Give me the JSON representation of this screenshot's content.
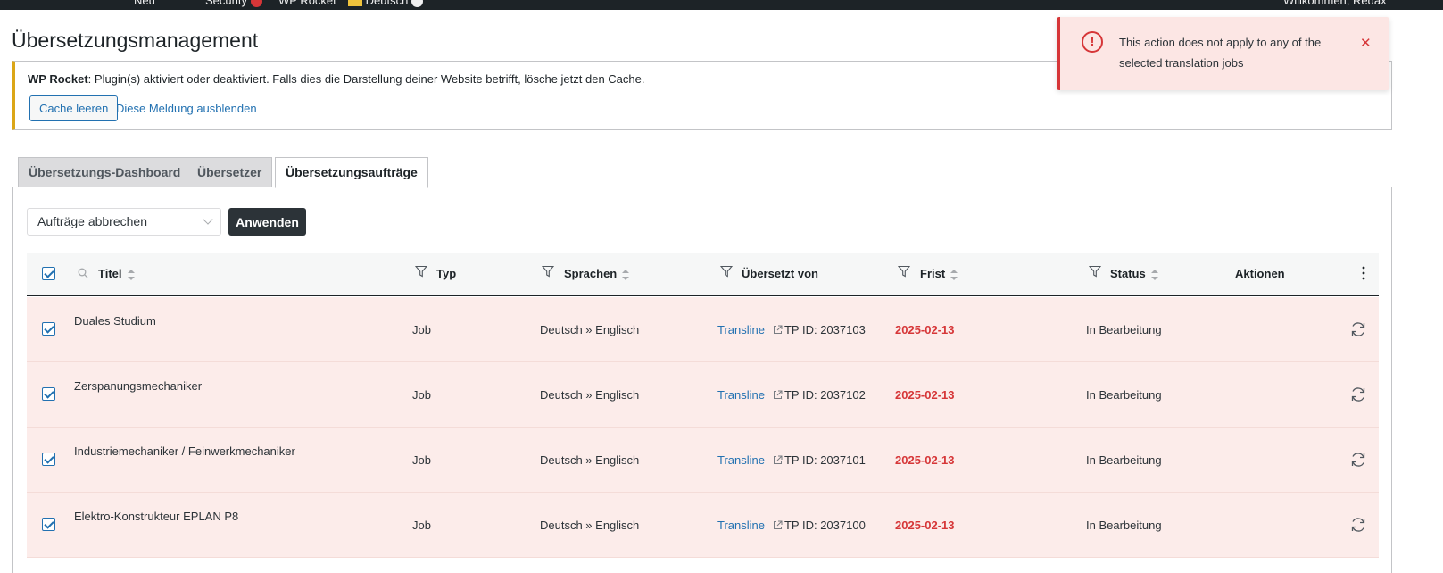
{
  "admin_bar": {
    "items": [
      "Neu",
      "Security",
      "WP Rocket",
      "Deutsch"
    ],
    "greeting": "Willkommen, Redax"
  },
  "page": {
    "title": "Übersetzungsmanagement"
  },
  "notice": {
    "brand": "WP Rocket",
    "message": ": Plugin(s) aktiviert oder deaktiviert. Falls dies die Darstellung deiner Website betrifft, lösche jetzt den Cache.",
    "cache_button": "Cache leeren",
    "dismiss_link": "Diese Meldung ausblenden"
  },
  "toast": {
    "message": "This action does not apply to any of the selected translation jobs",
    "icon": "alert-circle-icon"
  },
  "tabs": [
    {
      "label": "Übersetzungs-Dashboard"
    },
    {
      "label": "Übersetzer"
    },
    {
      "label": "Übersetzungsaufträge"
    }
  ],
  "bulk": {
    "selected": "Aufträge abbrechen",
    "apply": "Anwenden"
  },
  "columns": {
    "title": "Titel",
    "type": "Typ",
    "languages": "Sprachen",
    "translated_by": "Übersetzt von",
    "deadline": "Frist",
    "status": "Status",
    "actions": "Aktionen"
  },
  "rows": [
    {
      "title": "Duales Studium",
      "type": "Job",
      "languages": "Deutsch » Englisch",
      "translator": "Transline",
      "tp": "TP ID: 2037103",
      "deadline": "2025-02-13",
      "status": "In Bearbeitung"
    },
    {
      "title": "Zerspanungsmechaniker",
      "type": "Job",
      "languages": "Deutsch » Englisch",
      "translator": "Transline",
      "tp": "TP ID: 2037102",
      "deadline": "2025-02-13",
      "status": "In Bearbeitung"
    },
    {
      "title": "Industriemechaniker / Feinwerkmechaniker",
      "type": "Job",
      "languages": "Deutsch » Englisch",
      "translator": "Transline",
      "tp": "TP ID: 2037101",
      "deadline": "2025-02-13",
      "status": "In Bearbeitung"
    },
    {
      "title": "Elektro-Konstrukteur EPLAN P8",
      "type": "Job",
      "languages": "Deutsch » Englisch",
      "translator": "Transline",
      "tp": "TP ID: 2037100",
      "deadline": "2025-02-13",
      "status": "In Bearbeitung"
    }
  ],
  "colors": {
    "accent": "#2271b1",
    "error": "#d63638",
    "row_highlight": "#fcecea",
    "notice_warning": "#dba617"
  }
}
